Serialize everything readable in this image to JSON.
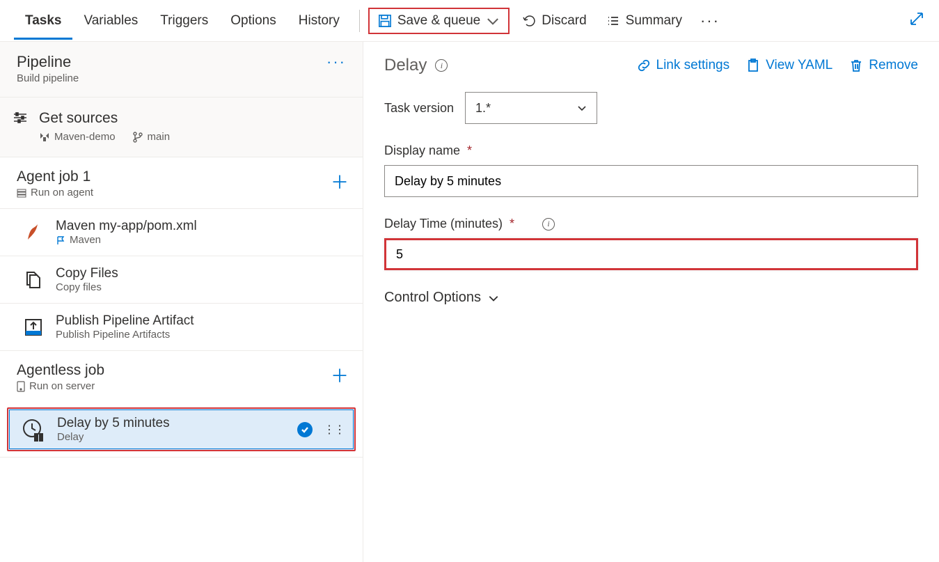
{
  "tabs": [
    "Tasks",
    "Variables",
    "Triggers",
    "Options",
    "History"
  ],
  "active_tab": 0,
  "toolbar": {
    "save_queue": "Save & queue",
    "discard": "Discard",
    "summary": "Summary"
  },
  "pipeline": {
    "title": "Pipeline",
    "sub": "Build pipeline"
  },
  "sources": {
    "title": "Get sources",
    "repo": "Maven-demo",
    "branch": "main"
  },
  "jobs": [
    {
      "title": "Agent job 1",
      "sub": "Run on agent",
      "tasks": [
        {
          "name": "Maven my-app/pom.xml",
          "type": "Maven",
          "icon": "maven"
        },
        {
          "name": "Copy Files",
          "type": "Copy files",
          "icon": "copy"
        },
        {
          "name": "Publish Pipeline Artifact",
          "type": "Publish Pipeline Artifacts",
          "icon": "publish"
        }
      ]
    },
    {
      "title": "Agentless job",
      "sub": "Run on server",
      "tasks": [
        {
          "name": "Delay by 5 minutes",
          "type": "Delay",
          "icon": "delay",
          "selected": true
        }
      ]
    }
  ],
  "panel": {
    "title": "Delay",
    "actions": {
      "link": "Link settings",
      "yaml": "View YAML",
      "remove": "Remove"
    },
    "task_version_label": "Task version",
    "task_version_value": "1.*",
    "display_name_label": "Display name",
    "display_name_value": "Delay by 5 minutes",
    "delay_time_label": "Delay Time (minutes)",
    "delay_time_value": "5",
    "control_options": "Control Options"
  }
}
